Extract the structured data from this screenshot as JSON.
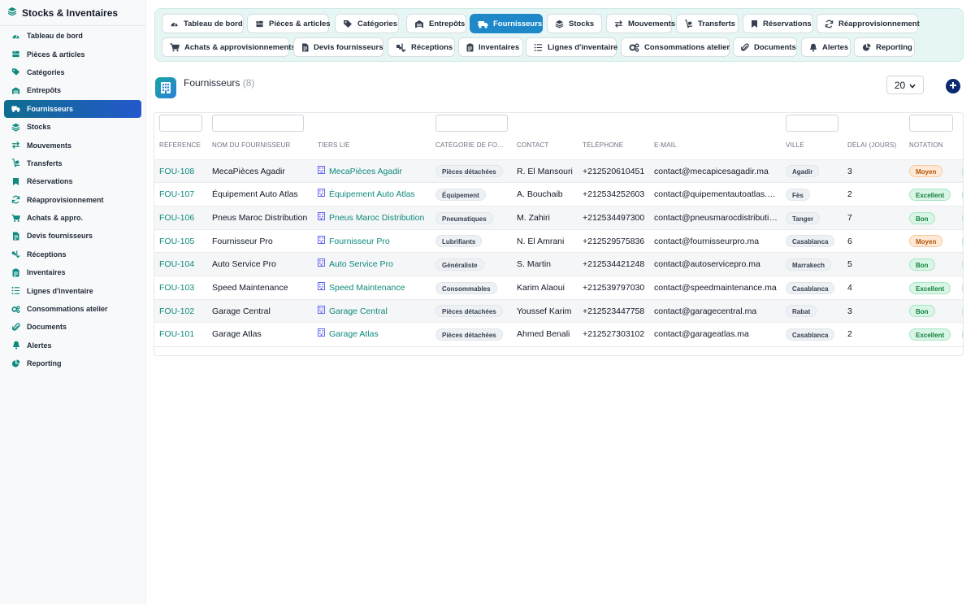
{
  "app": {
    "title": "Stocks & Inventaires"
  },
  "colors": {
    "accent": "#1e88c9",
    "link": "#0e8a7e",
    "brand_dark": "#0b2a6f"
  },
  "sidebar": {
    "items": [
      {
        "label": "Tableau de bord",
        "icon": "gauge-icon"
      },
      {
        "label": "Pièces & articles",
        "icon": "boxes-icon"
      },
      {
        "label": "Catégories",
        "icon": "tags-icon"
      },
      {
        "label": "Entrepôts",
        "icon": "warehouse-icon"
      },
      {
        "label": "Fournisseurs",
        "icon": "truck-icon",
        "active": true
      },
      {
        "label": "Stocks",
        "icon": "layers-icon"
      },
      {
        "label": "Mouvements",
        "icon": "exchange-icon"
      },
      {
        "label": "Transferts",
        "icon": "dolly-icon"
      },
      {
        "label": "Réservations",
        "icon": "bookmark-icon"
      },
      {
        "label": "Réapprovisionnement",
        "icon": "sync-icon"
      },
      {
        "label": "Achats & appro.",
        "icon": "cart-icon"
      },
      {
        "label": "Devis fournisseurs",
        "icon": "file-invoice-icon"
      },
      {
        "label": "Réceptions",
        "icon": "truck-loading-icon"
      },
      {
        "label": "Inventaires",
        "icon": "clipboard-icon"
      },
      {
        "label": "Lignes d'inventaire",
        "icon": "list-icon"
      },
      {
        "label": "Consommations atelier",
        "icon": "cogs-icon"
      },
      {
        "label": "Documents",
        "icon": "paperclip-icon"
      },
      {
        "label": "Alertes",
        "icon": "bell-icon"
      },
      {
        "label": "Reporting",
        "icon": "pie-chart-icon"
      }
    ]
  },
  "tabs": [
    {
      "label": "Tableau de bord",
      "icon": "gauge-icon"
    },
    {
      "label": "Pièces & articles",
      "icon": "boxes-icon"
    },
    {
      "label": "Catégories",
      "icon": "tags-icon"
    },
    {
      "label": "Entrepôts",
      "icon": "warehouse-icon"
    },
    {
      "label": "Fournisseurs",
      "icon": "truck-icon",
      "active": true
    },
    {
      "label": "Stocks",
      "icon": "layers-icon"
    },
    {
      "label": "Mouvements",
      "icon": "exchange-icon"
    },
    {
      "label": "Transferts",
      "icon": "dolly-icon"
    },
    {
      "label": "Réservations",
      "icon": "bookmark-icon"
    },
    {
      "label": "Réapprovisionnement",
      "icon": "sync-icon"
    },
    {
      "label": "Achats & approvisionnements",
      "icon": "cart-icon"
    },
    {
      "label": "Devis fournisseurs",
      "icon": "file-invoice-icon"
    },
    {
      "label": "Réceptions",
      "icon": "truck-loading-icon"
    },
    {
      "label": "Inventaires",
      "icon": "clipboard-icon"
    },
    {
      "label": "Lignes d'inventaire",
      "icon": "list-icon"
    },
    {
      "label": "Consommations atelier",
      "icon": "cogs-icon"
    },
    {
      "label": "Documents",
      "icon": "paperclip-icon"
    },
    {
      "label": "Alertes",
      "icon": "bell-icon"
    },
    {
      "label": "Reporting",
      "icon": "pie-chart-icon"
    }
  ],
  "page": {
    "title": "Fournisseurs",
    "count": "(8)",
    "per_page": "20"
  },
  "table": {
    "columns": [
      "RÉFÉRENCE",
      "NOM DU FOURNISSEUR",
      "TIERS LIÉ",
      "CATÉGORIE DE FO...",
      "CONTACT",
      "TÉLÉPHONE",
      "E-MAIL",
      "VILLE",
      "DÉLAI (JOURS)",
      "NOTATION"
    ],
    "rows": [
      {
        "ref": "FOU-108",
        "name": "MecaPièces Agadir",
        "tiers": "MecaPièces Agadir",
        "category": "Pièces détachées",
        "contact": "R. El Mansouri",
        "phone": "+212520610451",
        "email": "contact@mecapicesagadir.ma",
        "city": "Agadir",
        "delay": "3",
        "rating": "Moyen"
      },
      {
        "ref": "FOU-107",
        "name": "Équipement Auto Atlas",
        "tiers": "Équipement Auto Atlas",
        "category": "Équipement",
        "contact": "A. Bouchaib",
        "phone": "+212534252603",
        "email": "contact@quipementautoatlas.ma",
        "city": "Fès",
        "delay": "2",
        "rating": "Excellent"
      },
      {
        "ref": "FOU-106",
        "name": "Pneus Maroc Distribution",
        "tiers": "Pneus Maroc Distribution",
        "category": "Pneumatiques",
        "contact": "M. Zahiri",
        "phone": "+212534497300",
        "email": "contact@pneusmarocdistribution.ma",
        "city": "Tanger",
        "delay": "7",
        "rating": "Bon"
      },
      {
        "ref": "FOU-105",
        "name": "Fournisseur Pro",
        "tiers": "Fournisseur Pro",
        "category": "Lubrifiants",
        "contact": "N. El Amrani",
        "phone": "+212529575836",
        "email": "contact@fournisseurpro.ma",
        "city": "Casablanca",
        "delay": "6",
        "rating": "Moyen"
      },
      {
        "ref": "FOU-104",
        "name": "Auto Service Pro",
        "tiers": "Auto Service Pro",
        "category": "Généraliste",
        "contact": "S. Martin",
        "phone": "+212534421248",
        "email": "contact@autoservicepro.ma",
        "city": "Marrakech",
        "delay": "5",
        "rating": "Bon"
      },
      {
        "ref": "FOU-103",
        "name": "Speed Maintenance",
        "tiers": "Speed Maintenance",
        "category": "Consommables",
        "contact": "Karim Alaoui",
        "phone": "+212539797030",
        "email": "contact@speedmaintenance.ma",
        "city": "Casablanca",
        "delay": "4",
        "rating": "Excellent"
      },
      {
        "ref": "FOU-102",
        "name": "Garage Central",
        "tiers": "Garage Central",
        "category": "Pièces détachées",
        "contact": "Youssef Karim",
        "phone": "+212523447758",
        "email": "contact@garagecentral.ma",
        "city": "Rabat",
        "delay": "3",
        "rating": "Bon"
      },
      {
        "ref": "FOU-101",
        "name": "Garage Atlas",
        "tiers": "Garage Atlas",
        "category": "Pièces détachées",
        "contact": "Ahmed Benali",
        "phone": "+212527303102",
        "email": "contact@garageatlas.ma",
        "city": "Casablanca",
        "delay": "2",
        "rating": "Excellent"
      }
    ]
  }
}
